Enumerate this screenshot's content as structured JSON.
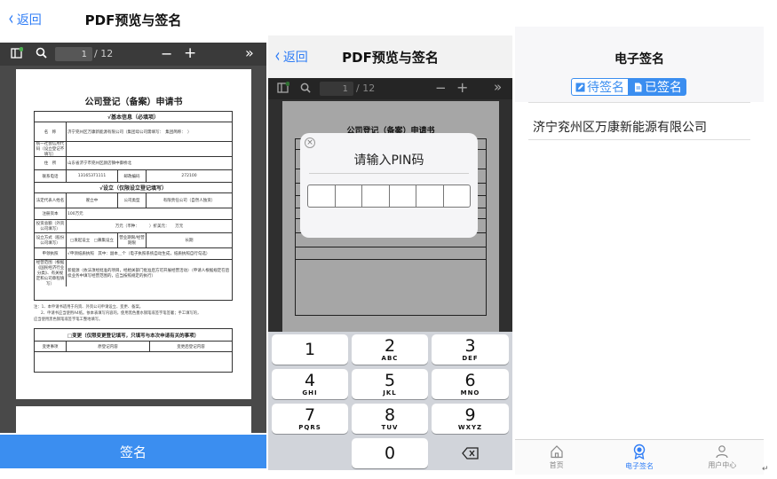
{
  "screen1": {
    "back_label": "返回",
    "title": "PDF预览与签名",
    "toolbar": {
      "page_current": "1",
      "page_total": "/ 12",
      "zoom_out": "−",
      "zoom_in": "+",
      "more": "»"
    },
    "document": {
      "title": "公司登记（备案）申请书",
      "section_basic": "√基本信息（必填项）",
      "rows_basic": [
        [
          "名　称",
          "济宁兖州区万康新能源有限公司（集团母公司需填写：　集团简称：　）"
        ],
        [
          "统一社会信用代码（设立登记不填写）",
          ""
        ],
        [
          "住　所",
          "山东省济宁市兖州区颜店镇中御桥北"
        ],
        [
          "联系电话",
          "13165371111",
          "邮政编码",
          "272100"
        ]
      ],
      "section_setup": "√设立（仅限设立登记填写）",
      "rows_setup": [
        [
          "法定代表人姓名",
          "翟立中",
          "公司类型",
          "有限责任公司（自然人独资）"
        ],
        [
          "注册资本",
          "100万元"
        ],
        [
          "投资总额（外资公司填写）",
          "万元（币种：　　　）折美元：　　万元"
        ],
        [
          "设立方式（股份公司填写）",
          "□发起设立　□募集设立",
          "营业期限/经营期限",
          "长期"
        ],
        [
          "申领执照",
          "√申领纸质执照　其中：副本＿个（电子执照系统自动生成，纸质执照自行勾选）"
        ],
        [
          "经营范围（根据《国民经济行业分类》、有关规定和公司章程填写）",
          "新能源（依法须经批准的项目，经相关部门批准后方可开展经营活动）（申请人根据规定在后续业务中填写经营范围的，应当按照规定的执行）"
        ]
      ],
      "notes": [
        "注：1、本申请书适用于内资、外资公司申请设立、变更、备案。",
        "2、申请书应当使用A4纸。依本表填写内容的，使用黑色墨水钢笔或签字笔签署；手工填写的，",
        "应当使用黑色钢笔或签字笔工整地填写。"
      ],
      "section_change": "□变更（仅限变更登记填写，只填写与本次申请有关的事项）",
      "change_headers": [
        "变更事项",
        "原登记内容",
        "变更后登记内容"
      ]
    },
    "sign_button": "签名"
  },
  "screen2": {
    "back_label": "返回",
    "title": "PDF预览与签名",
    "toolbar": {
      "page_current": "1",
      "page_total": "/ 12",
      "zoom_out": "−",
      "zoom_in": "+",
      "more": "»"
    },
    "document_title": "公司登记（备案）申请书",
    "pin_dialog": {
      "close": "×",
      "title": "请输入PIN码",
      "box_count": 6
    },
    "keypad": [
      {
        "num": "1",
        "letters": ""
      },
      {
        "num": "2",
        "letters": "ABC"
      },
      {
        "num": "3",
        "letters": "DEF"
      },
      {
        "num": "4",
        "letters": "GHI"
      },
      {
        "num": "5",
        "letters": "JKL"
      },
      {
        "num": "6",
        "letters": "MNO"
      },
      {
        "num": "7",
        "letters": "PQRS"
      },
      {
        "num": "8",
        "letters": "TUV"
      },
      {
        "num": "9",
        "letters": "WXYZ"
      },
      {
        "num": "0",
        "letters": ""
      }
    ]
  },
  "screen3": {
    "title": "电子签名",
    "segment": {
      "pending": "待签名",
      "signed": "已签名",
      "active": "signed"
    },
    "company": "济宁兖州区万康新能源有限公司",
    "tabs": [
      {
        "label": "首页",
        "icon": "home-icon",
        "active": false
      },
      {
        "label": "电子签名",
        "icon": "badge-icon",
        "active": true
      },
      {
        "label": "用户中心",
        "icon": "user-icon",
        "active": false
      }
    ]
  },
  "colors": {
    "accent": "#3b8ef0",
    "link": "#2f7df6",
    "toolbar": "#3a3a3a",
    "viewer_bg": "#494949"
  },
  "cursor_mark": "↵"
}
